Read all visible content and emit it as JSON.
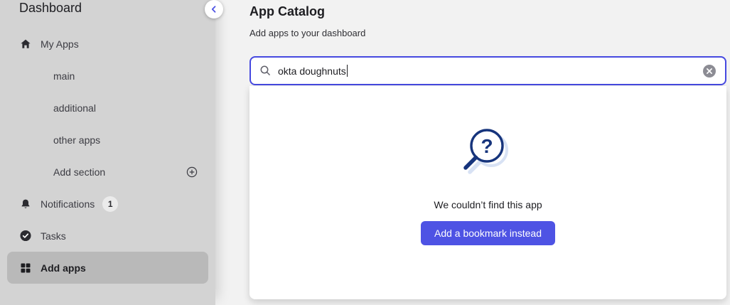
{
  "sidebar": {
    "title": "Dashboard",
    "collapse_icon": "chevron-left-icon",
    "items": [
      {
        "label": "My Apps",
        "icon": "home-icon"
      },
      {
        "label": "main",
        "icon": null
      },
      {
        "label": "additional",
        "icon": null
      },
      {
        "label": "other apps",
        "icon": null
      },
      {
        "label": "Add section",
        "icon": null,
        "trailing_icon": "plus-circle-icon"
      },
      {
        "label": "Notifications",
        "icon": "bell-icon",
        "badge": "1"
      },
      {
        "label": "Tasks",
        "icon": "check-circle-icon"
      },
      {
        "label": "Add apps",
        "icon": "grid-icon",
        "active": true
      }
    ]
  },
  "header": {
    "title": "App Catalog",
    "subtitle": "Add apps to your dashboard"
  },
  "search": {
    "value": "okta doughnuts",
    "leading_icon": "search-icon",
    "clear_icon": "x-circle-icon"
  },
  "empty_state": {
    "illustration": "magnifier-question-icon",
    "message": "We couldn’t find this app",
    "action_label": "Add a bookmark instead"
  },
  "colors": {
    "accent": "#4e53e4",
    "search_border": "#4649e0",
    "sidebar_bg": "#d3d3d3",
    "active_item_bg": "#b9b9b9",
    "page_bg": "#f2f2f2",
    "illustration_navy": "#16347c",
    "illustration_shadow": "#d8e2f4",
    "clear_icon_fill": "#8c8c94"
  }
}
